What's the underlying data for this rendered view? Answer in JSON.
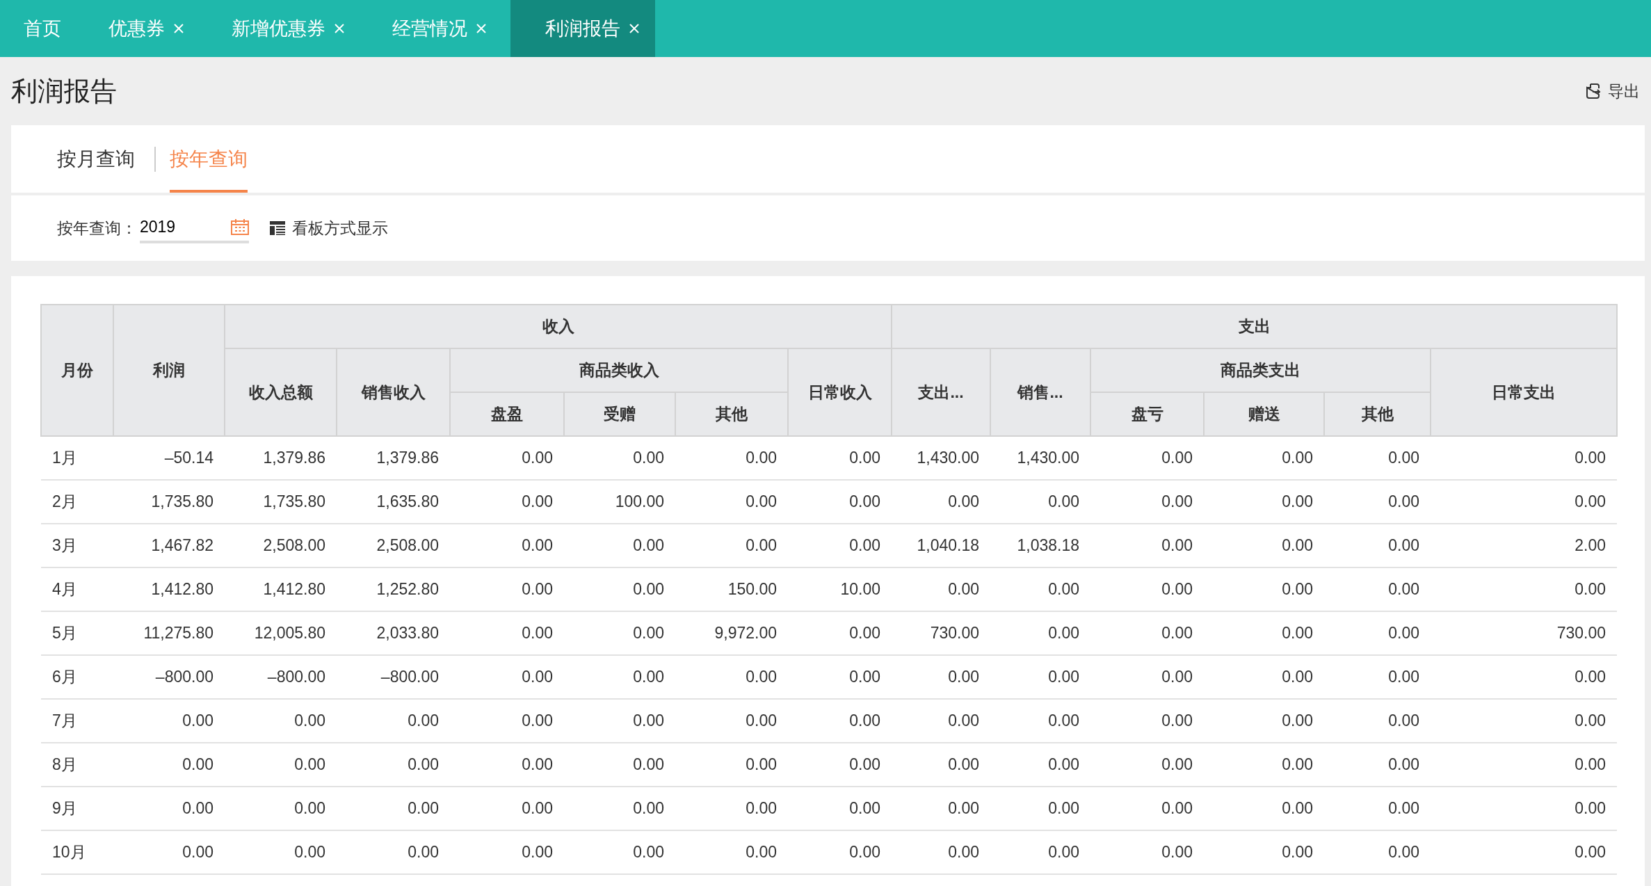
{
  "tabs": [
    {
      "label": "首页",
      "closable": false,
      "selected": false
    },
    {
      "label": "优惠券",
      "closable": true,
      "selected": false
    },
    {
      "label": "新增优惠券",
      "closable": true,
      "selected": false
    },
    {
      "label": "经营情况",
      "closable": true,
      "selected": false
    },
    {
      "label": "利润报告",
      "closable": true,
      "selected": true
    }
  ],
  "page": {
    "title": "利润报告",
    "export_label": "导出"
  },
  "query_tabs": [
    {
      "label": "按月查询",
      "selected": false
    },
    {
      "label": "按年查询",
      "selected": true
    }
  ],
  "filter": {
    "label": "按年查询：",
    "value": "2019",
    "board_label": "看板方式显示"
  },
  "table": {
    "header_rows": [
      [
        {
          "text": "月份",
          "rowspan": 3
        },
        {
          "text": "利润",
          "rowspan": 3
        },
        {
          "text": "收入",
          "colspan": 6
        },
        {
          "text": "支出",
          "colspan": 6
        }
      ],
      [
        {
          "text": "收入总额",
          "rowspan": 2
        },
        {
          "text": "销售收入",
          "rowspan": 2
        },
        {
          "text": "商品类收入",
          "colspan": 3
        },
        {
          "text": "日常收入",
          "rowspan": 2
        },
        {
          "text": "支出...",
          "rowspan": 2
        },
        {
          "text": "销售...",
          "rowspan": 2
        },
        {
          "text": "商品类支出",
          "colspan": 3
        },
        {
          "text": "日常支出",
          "rowspan": 2
        }
      ],
      [
        {
          "text": "盘盈"
        },
        {
          "text": "受赠"
        },
        {
          "text": "其他"
        },
        {
          "text": "盘亏"
        },
        {
          "text": "赠送"
        },
        {
          "text": "其他"
        }
      ]
    ],
    "rows": [
      [
        "1月",
        "–50.14",
        "1,379.86",
        "1,379.86",
        "0.00",
        "0.00",
        "0.00",
        "0.00",
        "1,430.00",
        "1,430.00",
        "0.00",
        "0.00",
        "0.00",
        "0.00"
      ],
      [
        "2月",
        "1,735.80",
        "1,735.80",
        "1,635.80",
        "0.00",
        "100.00",
        "0.00",
        "0.00",
        "0.00",
        "0.00",
        "0.00",
        "0.00",
        "0.00",
        "0.00"
      ],
      [
        "3月",
        "1,467.82",
        "2,508.00",
        "2,508.00",
        "0.00",
        "0.00",
        "0.00",
        "0.00",
        "1,040.18",
        "1,038.18",
        "0.00",
        "0.00",
        "0.00",
        "2.00"
      ],
      [
        "4月",
        "1,412.80",
        "1,412.80",
        "1,252.80",
        "0.00",
        "0.00",
        "150.00",
        "10.00",
        "0.00",
        "0.00",
        "0.00",
        "0.00",
        "0.00",
        "0.00"
      ],
      [
        "5月",
        "11,275.80",
        "12,005.80",
        "2,033.80",
        "0.00",
        "0.00",
        "9,972.00",
        "0.00",
        "730.00",
        "0.00",
        "0.00",
        "0.00",
        "0.00",
        "730.00"
      ],
      [
        "6月",
        "–800.00",
        "–800.00",
        "–800.00",
        "0.00",
        "0.00",
        "0.00",
        "0.00",
        "0.00",
        "0.00",
        "0.00",
        "0.00",
        "0.00",
        "0.00"
      ],
      [
        "7月",
        "0.00",
        "0.00",
        "0.00",
        "0.00",
        "0.00",
        "0.00",
        "0.00",
        "0.00",
        "0.00",
        "0.00",
        "0.00",
        "0.00",
        "0.00"
      ],
      [
        "8月",
        "0.00",
        "0.00",
        "0.00",
        "0.00",
        "0.00",
        "0.00",
        "0.00",
        "0.00",
        "0.00",
        "0.00",
        "0.00",
        "0.00",
        "0.00"
      ],
      [
        "9月",
        "0.00",
        "0.00",
        "0.00",
        "0.00",
        "0.00",
        "0.00",
        "0.00",
        "0.00",
        "0.00",
        "0.00",
        "0.00",
        "0.00",
        "0.00"
      ],
      [
        "10月",
        "0.00",
        "0.00",
        "0.00",
        "0.00",
        "0.00",
        "0.00",
        "0.00",
        "0.00",
        "0.00",
        "0.00",
        "0.00",
        "0.00",
        "0.00"
      ]
    ]
  }
}
